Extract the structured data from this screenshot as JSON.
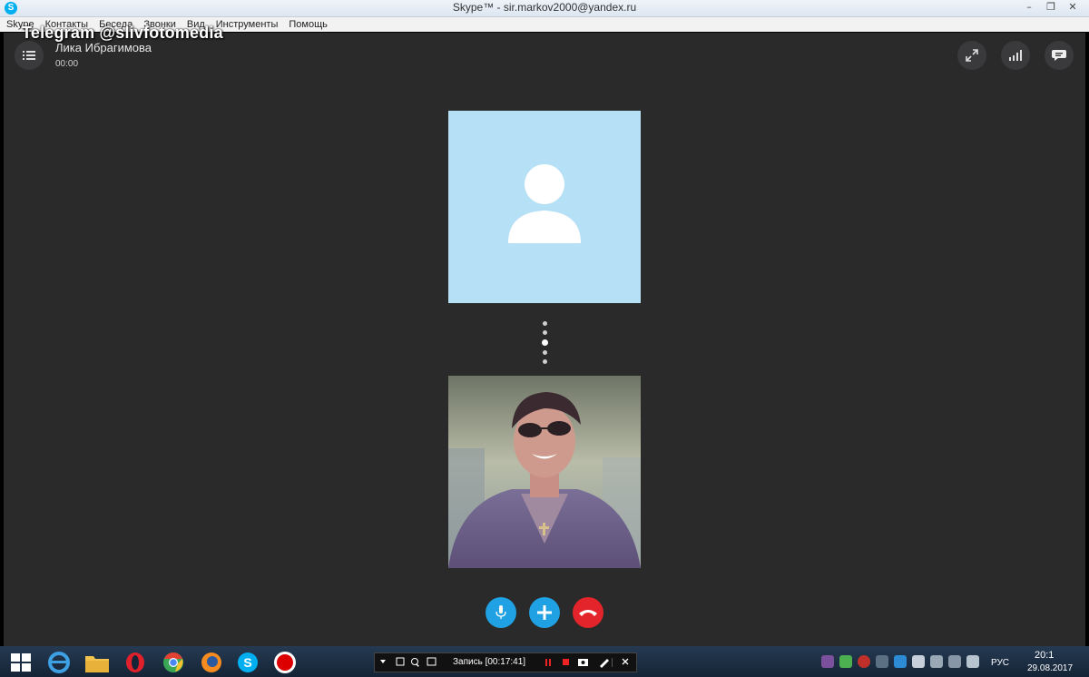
{
  "window": {
    "app_icon": "S",
    "title": "Skype™ - sir.markov2000@yandex.ru",
    "controls": [
      "–",
      "❐",
      "✕"
    ]
  },
  "menu": [
    "Skype",
    "Контакты",
    "Беседа",
    "Звонки",
    "Вид",
    "Инструменты",
    "Помощь"
  ],
  "watermark": "Telegram @slivfotomedia",
  "call": {
    "contact_name": "Лика Ибрагимова",
    "duration": "00:00"
  },
  "icons": {
    "menu": "list-icon",
    "fullscreen": "expand-icon",
    "quality": "signal-bars-icon",
    "chat": "chat-bubble-icon",
    "mic": "microphone-icon",
    "add": "plus-icon",
    "hangup": "hang-up-icon"
  },
  "colors": {
    "call_bg": "#2a2a2b",
    "avatar_bg": "#b6e0f6",
    "skype_blue": "#1fa1e3",
    "hangup_red": "#e3242b"
  },
  "recorder": {
    "label": "Запись [00:17:41]"
  },
  "taskbar": {
    "language": "РУС",
    "time": "20:1",
    "date": "29.08.2017"
  }
}
